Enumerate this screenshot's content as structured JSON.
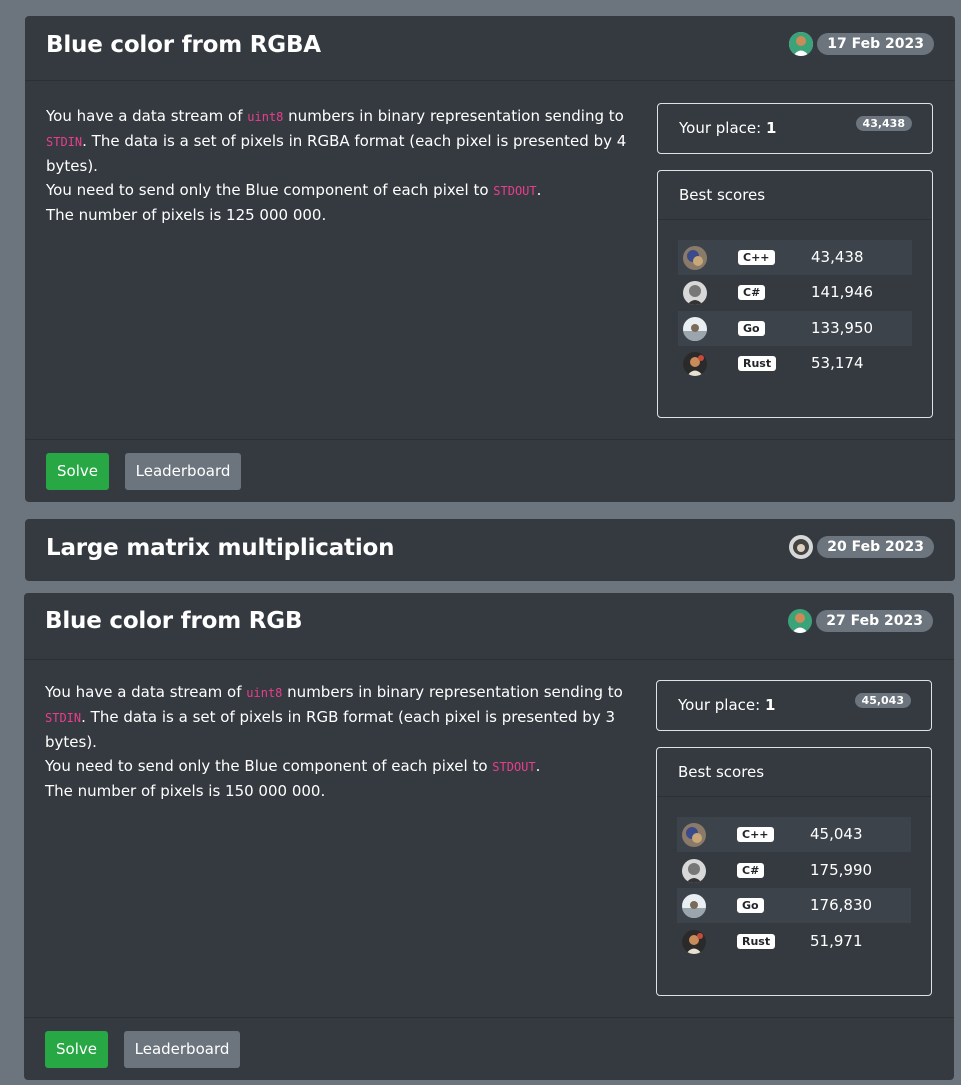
{
  "cards": [
    {
      "title": "Blue color from RGBA",
      "date": "17 Feb 2023",
      "desc": {
        "l1a": "You have a data stream of ",
        "l1code": "uint8",
        "l1b": " numbers in binary representation sending to",
        "l2code": "STDIN",
        "l2b": ". The data is a set of pixels in RGBA format (each pixel is presented by 4",
        "l3": "bytes).",
        "l4a": "You need to send only the Blue component of each pixel to ",
        "l4code": "STDOUT",
        "l4b": ".",
        "l5": "The number of pixels is 125 000 000."
      },
      "your_place_label": "Your place:",
      "your_place": "1",
      "place_score": "43,438",
      "best_scores_title": "Best scores",
      "scores": [
        {
          "lang": "C++",
          "value": "43,438"
        },
        {
          "lang": "C#",
          "value": "141,946"
        },
        {
          "lang": "Go",
          "value": "133,950"
        },
        {
          "lang": "Rust",
          "value": "53,174"
        }
      ],
      "solve_label": "Solve",
      "leaderboard_label": "Leaderboard"
    },
    {
      "title": "Large matrix multiplication",
      "date": "20 Feb 2023"
    },
    {
      "title": "Blue color from RGB",
      "date": "27 Feb 2023",
      "desc": {
        "l1a": "You have a data stream of ",
        "l1code": "uint8",
        "l1b": " numbers in binary representation sending to",
        "l2code": "STDIN",
        "l2b": ". The data is a set of pixels in RGB format (each pixel is presented by 3 bytes).",
        "l4a": "You need to send only the Blue component of each pixel to ",
        "l4code": "STDOUT",
        "l4b": ".",
        "l5": "The number of pixels is 150 000 000."
      },
      "your_place_label": "Your place:",
      "your_place": "1",
      "place_score": "45,043",
      "best_scores_title": "Best scores",
      "scores": [
        {
          "lang": "C++",
          "value": "45,043"
        },
        {
          "lang": "C#",
          "value": "175,990"
        },
        {
          "lang": "Go",
          "value": "176,830"
        },
        {
          "lang": "Rust",
          "value": "51,971"
        }
      ],
      "solve_label": "Solve",
      "leaderboard_label": "Leaderboard"
    }
  ],
  "colors": {
    "page_bg": "#6c757d",
    "card_bg": "#343a40",
    "solve": "#28a745",
    "secondary": "#6c757d",
    "code": "#e83e8c"
  }
}
